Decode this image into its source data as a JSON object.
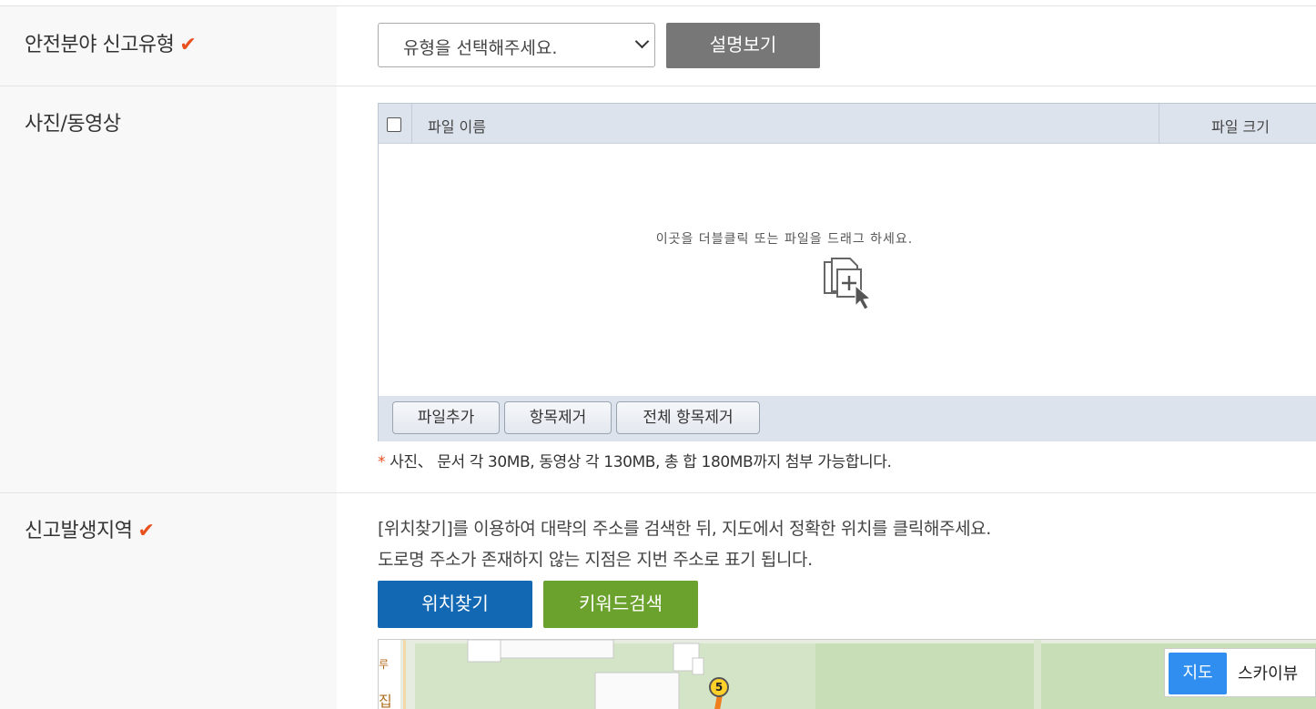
{
  "report_type": {
    "label": "안전분야 신고유형",
    "select_placeholder": "유형을 선택해주세요.",
    "desc_button": "설명보기"
  },
  "media": {
    "label": "사진/동영상",
    "columns": [
      "파일 이름",
      "파일 크기"
    ],
    "hint": "이곳을 더블클릭 또는 파일을 드래그 하세요.",
    "buttons": {
      "add": "파일추가",
      "remove": "항목제거",
      "remove_all": "전체 항목제거"
    },
    "note_star": "*",
    "note": "사진、 문서 각 30MB, 동영상 각 130MB, 총 합 180MB까지 첨부 가능합니다."
  },
  "location": {
    "label": "신고발생지역",
    "desc1": "[위치찾기]를 이용하여 대략의 주소를 검색한 뒤, 지도에서 정확한 위치를 클릭해주세요.",
    "desc2": "도로명 주소가 존재하지 않는 지점은 지번 주소로 표기 됩니다.",
    "find_button": "위치찾기",
    "keyword_button": "키워드검색",
    "map_toggle": {
      "map": "지도",
      "skyview": "스카이뷰"
    },
    "map_labels": {
      "route_number": "5",
      "edge_glyph_1": "루",
      "edge_glyph_2": "집"
    }
  },
  "colors": {
    "required_check": "#e8501e",
    "find_button": "#1268b3",
    "keyword_button": "#6ba22e",
    "map_toggle_active": "#2f8ef0"
  },
  "icons": {
    "required": "checkmark-icon",
    "file_drop": "file-drop-icon",
    "select_arrow": "chevron-down-icon"
  }
}
